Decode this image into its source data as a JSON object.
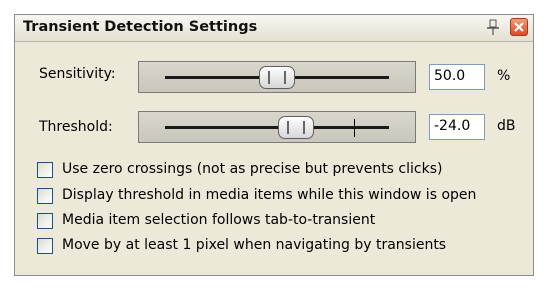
{
  "window": {
    "title": "Transient Detection Settings",
    "pin_icon": "pin-icon",
    "close_icon": "close-icon",
    "close_color": "#e55a2d"
  },
  "sensitivity": {
    "label": "Sensitivity:",
    "value": "50.0",
    "unit": "%",
    "slider_level": 0.5
  },
  "threshold": {
    "label": "Threshold:",
    "value": "-24.0",
    "unit": "dB",
    "slider_level": 0.6
  },
  "options": [
    {
      "label": "Use zero crossings (not as precise but prevents clicks)",
      "checked": false
    },
    {
      "label": "Display threshold in media items while this window is open",
      "checked": false
    },
    {
      "label": "Media item selection follows tab-to-transient",
      "checked": false
    },
    {
      "label": "Move by at least 1 pixel when navigating by transients",
      "checked": false
    }
  ]
}
